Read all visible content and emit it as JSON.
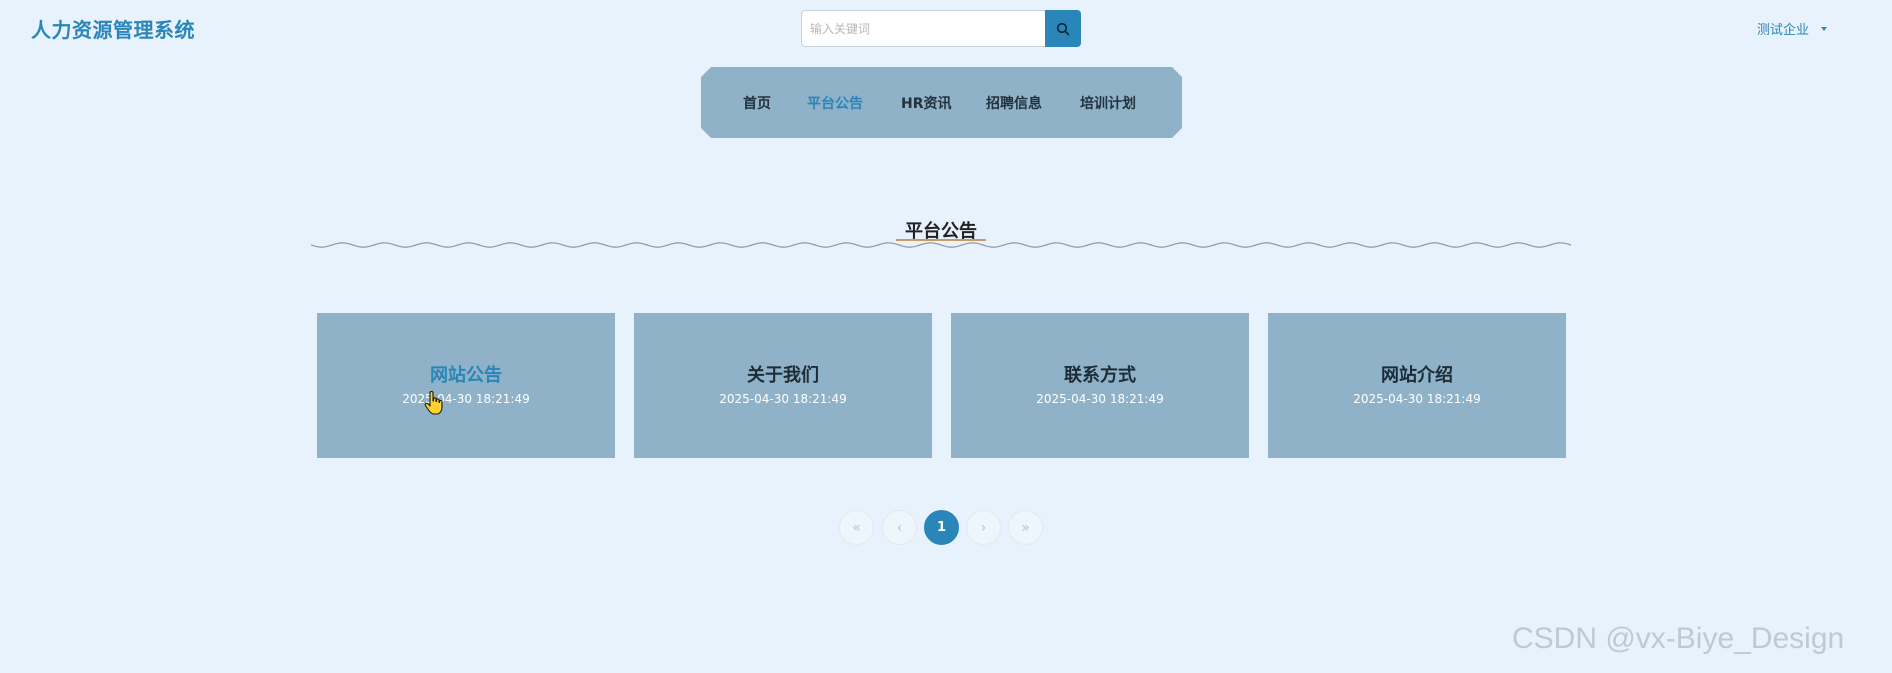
{
  "app": {
    "title": "人力资源管理系统"
  },
  "search": {
    "placeholder": "输入关键词",
    "value": "",
    "icon": "search-icon"
  },
  "user": {
    "label": "测试企业",
    "icon": "caret-down-icon"
  },
  "nav": {
    "items": [
      {
        "label": "首页",
        "active": false
      },
      {
        "label": "平台公告",
        "active": true
      },
      {
        "label": "HR资讯",
        "active": false
      },
      {
        "label": "招聘信息",
        "active": false
      },
      {
        "label": "培训计划",
        "active": false
      }
    ]
  },
  "section": {
    "title": "平台公告"
  },
  "cards": [
    {
      "title": "网站公告",
      "date": "2025-04-30 18:21:49"
    },
    {
      "title": "关于我们",
      "date": "2025-04-30 18:21:49"
    },
    {
      "title": "联系方式",
      "date": "2025-04-30 18:21:49"
    },
    {
      "title": "网站介绍",
      "date": "2025-04-30 18:21:49"
    }
  ],
  "pagination": {
    "first": "«",
    "prev": "‹",
    "current": "1",
    "next": "›",
    "last": "»"
  },
  "colors": {
    "accent": "#2a86b8",
    "background": "#e8f2fc",
    "panel": "#8fb2c9"
  },
  "watermark": "CSDN @vx-Biye_Design"
}
